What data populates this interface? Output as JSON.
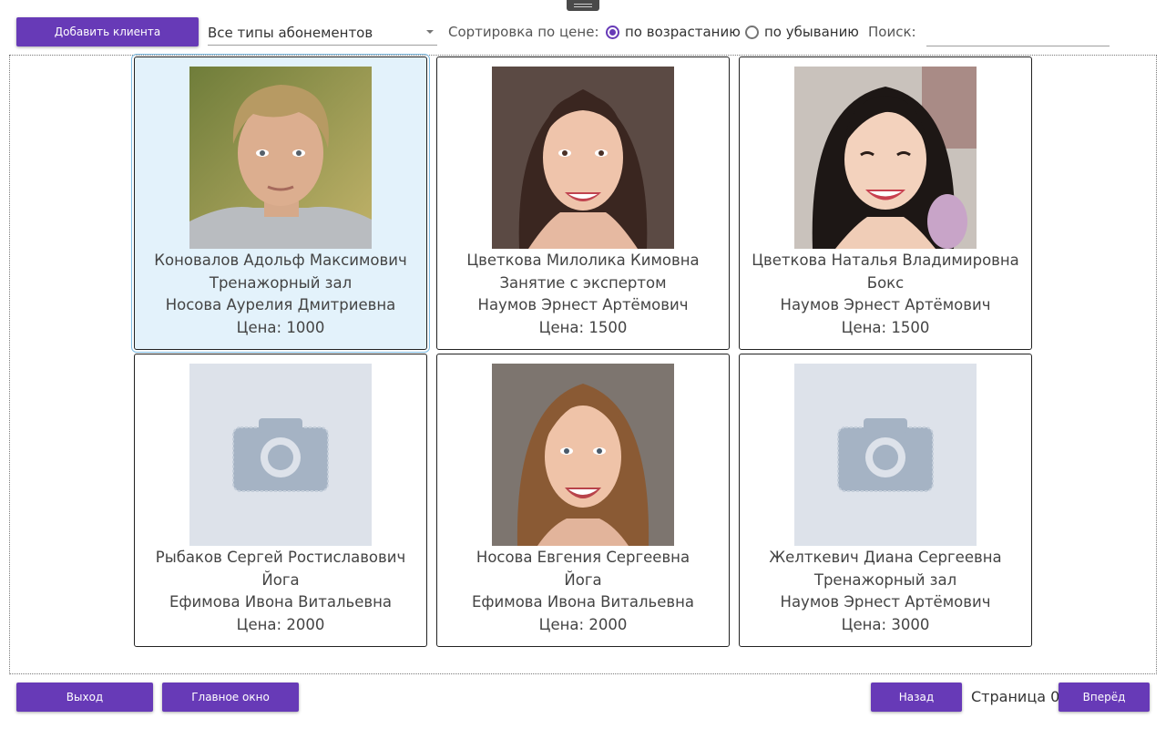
{
  "toolbar": {
    "add_client": "Добавить клиента",
    "filter_selected": "Все типы абонементов",
    "sort_label": "Сортировка по цене:",
    "sort_asc": "по возрастанию",
    "sort_desc": "по убыванию",
    "sort_selected": "asc",
    "search_label": "Поиск:",
    "search_value": ""
  },
  "cards": [
    {
      "name": "Коновалов Адольф Максимович",
      "type": "Тренажорный зал",
      "trainer": "Носова Аурелия Дмитриевна",
      "price": "Цена: 1000",
      "photo": "male-portrait-blond",
      "selected": true
    },
    {
      "name": "Цветкова Милолика Кимовна",
      "type": "Занятие с экспертом",
      "trainer": "Наумов Эрнест Артёмович",
      "price": "Цена: 1500",
      "photo": "female-portrait-dark-hair"
    },
    {
      "name": "Цветкова Наталья Владимировна",
      "type": "Бокс",
      "trainer": "Наумов Эрнест Артёмович",
      "price": "Цена: 1500",
      "photo": "female-portrait-black-hair"
    },
    {
      "name": "Рыбаков Сергей Ростиславович",
      "type": "Йога",
      "trainer": "Ефимова Ивона Витальевна",
      "price": "Цена: 2000",
      "photo": "camera-placeholder-icon"
    },
    {
      "name": "Носова Евгения Сергеевна",
      "type": "Йога",
      "trainer": "Ефимова Ивона Витальевна",
      "price": "Цена: 2000",
      "photo": "female-portrait-brown-hair"
    },
    {
      "name": "Желткевич Диана Сергеевна",
      "type": "Тренажорный зал",
      "trainer": "Наумов Эрнест Артёмович",
      "price": "Цена: 3000",
      "photo": "camera-placeholder-icon"
    }
  ],
  "footer": {
    "exit": "Выход",
    "main_window": "Главное окно",
    "back": "Назад",
    "page_text": "Страница 0",
    "forward": "Вперёд"
  },
  "colors": {
    "accent": "#673ab7",
    "selected_card": "#e3f2fb",
    "placeholder_bg": "#dde2ea",
    "placeholder_icon": "#a5b3c4"
  }
}
